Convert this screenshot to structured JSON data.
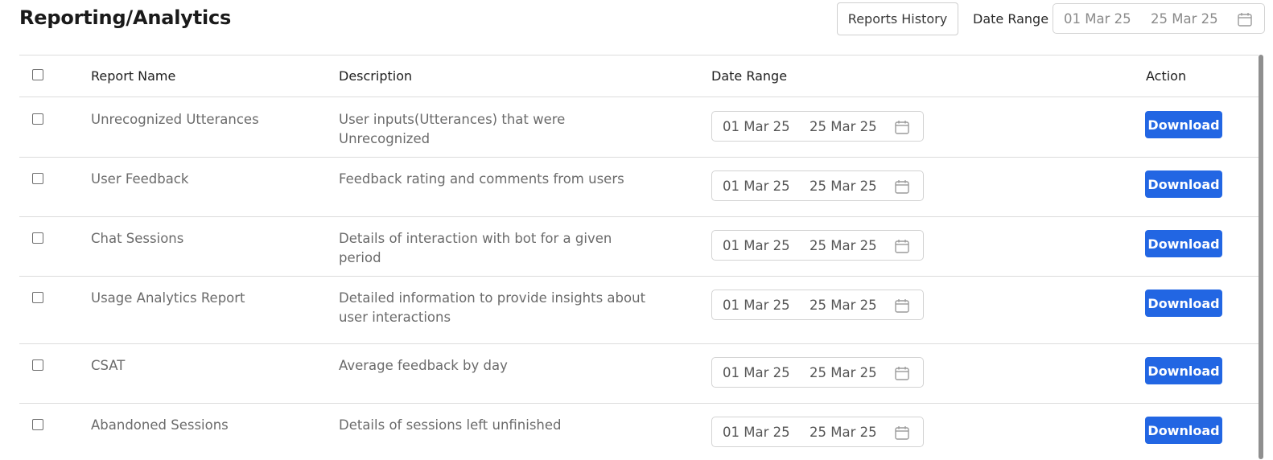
{
  "header": {
    "title": "Reporting/Analytics",
    "history_label": "Reports History",
    "date_range_label": "Date Range",
    "date_from": "01 Mar 25",
    "date_to": "25 Mar 25"
  },
  "table": {
    "columns": {
      "name": "Report Name",
      "description": "Description",
      "date_range": "Date Range",
      "action": "Action"
    },
    "rows": [
      {
        "name": "Unrecognized Utterances",
        "description": "User inputs(Utterances) that were Unrecognized",
        "from": "01 Mar 25",
        "to": "25 Mar 25",
        "action": "Download"
      },
      {
        "name": "User Feedback",
        "description": "Feedback rating and comments from users",
        "from": "01 Mar 25",
        "to": "25 Mar 25",
        "action": "Download"
      },
      {
        "name": "Chat Sessions",
        "description": "Details of interaction with bot for a given period",
        "from": "01 Mar 25",
        "to": "25 Mar 25",
        "action": "Download"
      },
      {
        "name": "Usage Analytics Report",
        "description": "Detailed information to provide insights about user interactions",
        "from": "01 Mar 25",
        "to": "25 Mar 25",
        "action": "Download"
      },
      {
        "name": "CSAT",
        "description": "Average feedback by day",
        "from": "01 Mar 25",
        "to": "25 Mar 25",
        "action": "Download"
      },
      {
        "name": "Abandoned Sessions",
        "description": "Details of sessions left unfinished",
        "from": "01 Mar 25",
        "to": "25 Mar 25",
        "action": "Download"
      }
    ]
  },
  "colors": {
    "accent": "#2266e3",
    "border": "#dcdcdc"
  }
}
